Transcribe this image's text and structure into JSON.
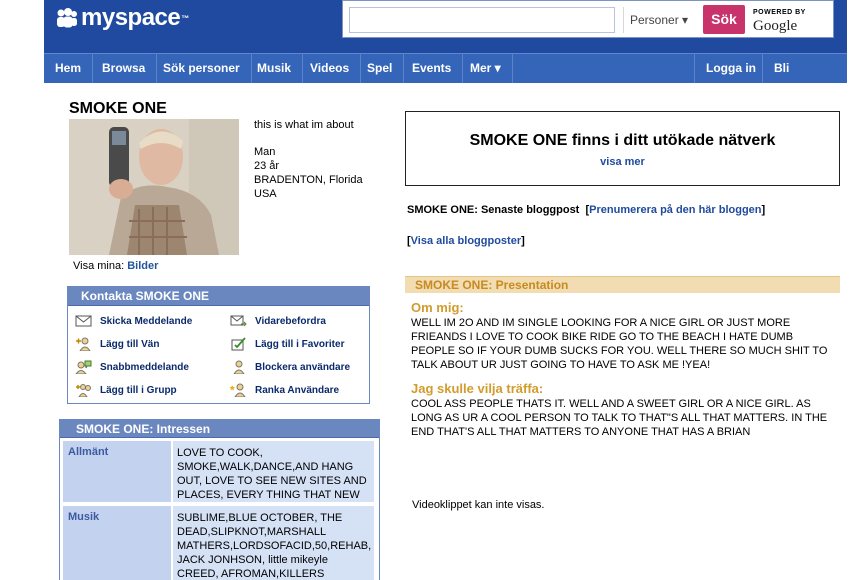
{
  "header": {
    "logo_text": "myspace",
    "logo_tm": "™",
    "search_placeholder": "",
    "search_scope": "Personer ▾",
    "search_button": "Sök",
    "powered_by": "POWERED BY",
    "google": "Google"
  },
  "nav": {
    "items": [
      "Hem",
      "Browsa",
      "Sök personer",
      "Musik",
      "Videos",
      "Spel",
      "Events",
      "Mer ▾"
    ],
    "right_items": [
      "Logga in",
      "Bli medlem"
    ]
  },
  "profile": {
    "name": "SMOKE ONE",
    "headline": "this is what im about",
    "gender": "Man",
    "age": "23 år",
    "city": "BRADENTON, Florida",
    "country": "USA",
    "view_label": "Visa mina:",
    "pictures_link": "Bilder"
  },
  "contact": {
    "title": "Kontakta SMOKE ONE",
    "items": [
      {
        "label": "Skicka Meddelande",
        "icon": "mail-icon"
      },
      {
        "label": "Vidarebefordra",
        "icon": "forward-mail-icon"
      },
      {
        "label": "Lägg till Vän",
        "icon": "add-friend-icon"
      },
      {
        "label": "Lägg till i Favoriter",
        "icon": "favorite-icon"
      },
      {
        "label": "Snabbmeddelande",
        "icon": "instant-message-icon"
      },
      {
        "label": "Blockera användare",
        "icon": "block-user-icon"
      },
      {
        "label": "Lägg till i Grupp",
        "icon": "add-group-icon"
      },
      {
        "label": "Ranka Användare",
        "icon": "rank-user-icon"
      }
    ]
  },
  "interests": {
    "title": "SMOKE ONE: Intressen",
    "rows": [
      {
        "label": "Allmänt",
        "value": "LOVE TO COOK, SMOKE,WALK,DANCE,AND HANG OUT, LOVE TO SEE NEW SITES AND PLACES, EVERY THING THAT NEW"
      },
      {
        "label": "Musik",
        "value": "SUBLIME,BLUE OCTOBER, THE DEAD,SLIPKNOT,MARSHALL MATHERS,LORDSOFACID,50,REHAB, JACK JONHSON, little mikeyle CREED, AFROMAN,KILLERS"
      }
    ]
  },
  "extended": {
    "title": "SMOKE ONE finns i ditt utökade nätverk",
    "link": "visa mer"
  },
  "blog": {
    "latest_label": "SMOKE ONE: Senaste bloggpost",
    "subscribe_link": "Prenumerera på den här bloggen",
    "view_all_link": "Visa alla bloggposter"
  },
  "presentation": {
    "title": "SMOKE ONE: Presentation",
    "about_label": "Om mig:",
    "about_text": "WELL IM 2O AND IM SINGLE LOOKING FOR A NICE GIRL OR JUST MORE FRIEANDS I LOVE TO COOK BIKE RIDE GO TO THE BEACH I HATE DUMB PEOPLE SO IF YOUR DUMB SUCKS FOR YOU. WELL THERE SO MUCH SHIT TO TALK ABOUT UR JUST GOING TO HAVE TO ASK ME !YEA!",
    "meet_label": "Jag skulle vilja träffa:",
    "meet_text": "COOL ASS PEOPLE THATS IT. WELL AND A SWEET GIRL OR A NICE GIRL. AS LONG AS UR A COOL PERSON TO TALK TO THAT\"S ALL THAT MATTERS. IN THE END THAT'S ALL THAT MATTERS TO ANYONE THAT HAS A BRIAN",
    "video_message": "Videoklippet kan inte visas."
  }
}
